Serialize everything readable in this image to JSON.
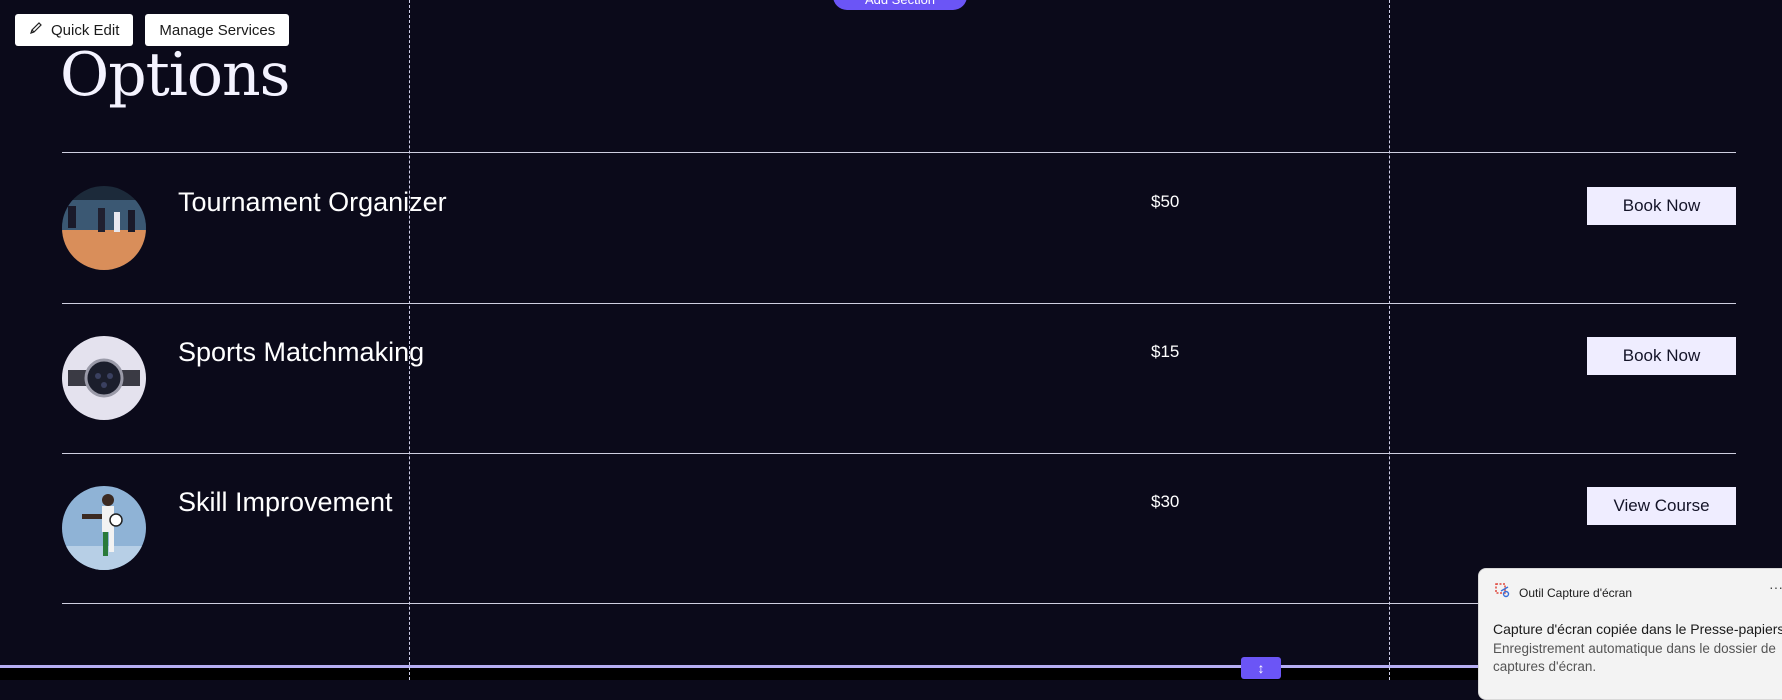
{
  "toolbar": {
    "quick_edit_label": "Quick Edit",
    "manage_services_label": "Manage Services",
    "add_section_label": "Add Section"
  },
  "page": {
    "title": "Options"
  },
  "services": [
    {
      "name": "Tournament Organizer",
      "price": "$50",
      "button": "Book Now",
      "image": "volleyball-photo"
    },
    {
      "name": "Sports Matchmaking",
      "price": "$15",
      "button": "Book Now",
      "image": "wristwatch-photo"
    },
    {
      "name": "Skill Improvement",
      "price": "$30",
      "button": "View Course",
      "image": "soccer-player-photo"
    }
  ],
  "notification": {
    "app_name": "Outil Capture d'écran",
    "title": "Capture d'écran copiée dans le Presse-papiers",
    "body_line1": "Enregistrement automatique dans le dossier de",
    "body_line2": "captures d'écran.",
    "more_label": "···"
  },
  "colors": {
    "background": "#0b0a1a",
    "accent": "#6b55f6",
    "button_bg": "#efedff"
  }
}
